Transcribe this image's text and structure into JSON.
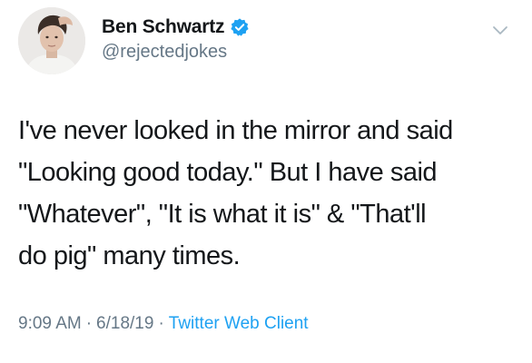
{
  "author": {
    "display_name": "Ben Schwartz",
    "handle": "@rejectedjokes",
    "verified": true,
    "avatar_icon": "profile-photo"
  },
  "tweet": {
    "lines": [
      "I've never looked in the mirror and said",
      "\"Looking good today.\" But I have said",
      "\"Whatever\", \"It is what it is\" & \"That'll",
      "do pig\" many times."
    ]
  },
  "meta": {
    "time": "9:09 AM",
    "separator": "·",
    "date": "6/18/19",
    "source": "Twitter Web Client"
  },
  "colors": {
    "verified_badge": "#1da1f2",
    "secondary_text": "#657786",
    "link": "#1da1f2"
  },
  "icons": {
    "menu": "chevron-down-icon",
    "verified": "verified-badge-icon"
  }
}
